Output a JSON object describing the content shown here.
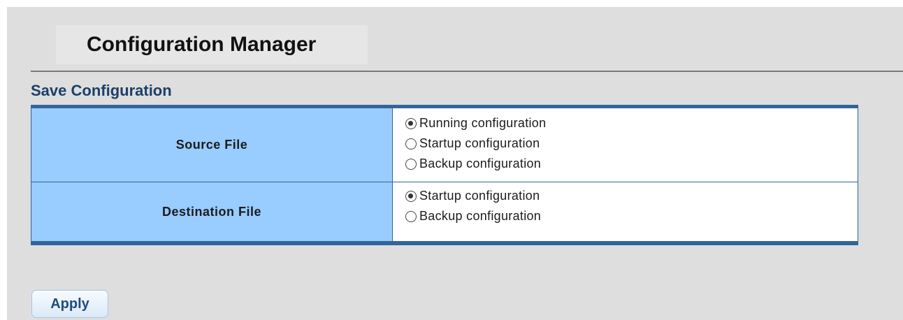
{
  "header": {
    "title": "Configuration Manager"
  },
  "section": {
    "title": "Save Configuration"
  },
  "source_file": {
    "label": "Source File",
    "options": [
      {
        "label": "Running configuration",
        "checked": true
      },
      {
        "label": "Startup configuration",
        "checked": false
      },
      {
        "label": "Backup configuration",
        "checked": false
      }
    ]
  },
  "destination_file": {
    "label": "Destination File",
    "options": [
      {
        "label": "Startup configuration",
        "checked": true
      },
      {
        "label": "Backup configuration",
        "checked": false
      }
    ]
  },
  "actions": {
    "apply_label": "Apply"
  },
  "colors": {
    "panel_bg": "#dedede",
    "label_cell_bg": "#99ccff",
    "table_border": "#31659c",
    "section_title": "#1d3f68"
  }
}
